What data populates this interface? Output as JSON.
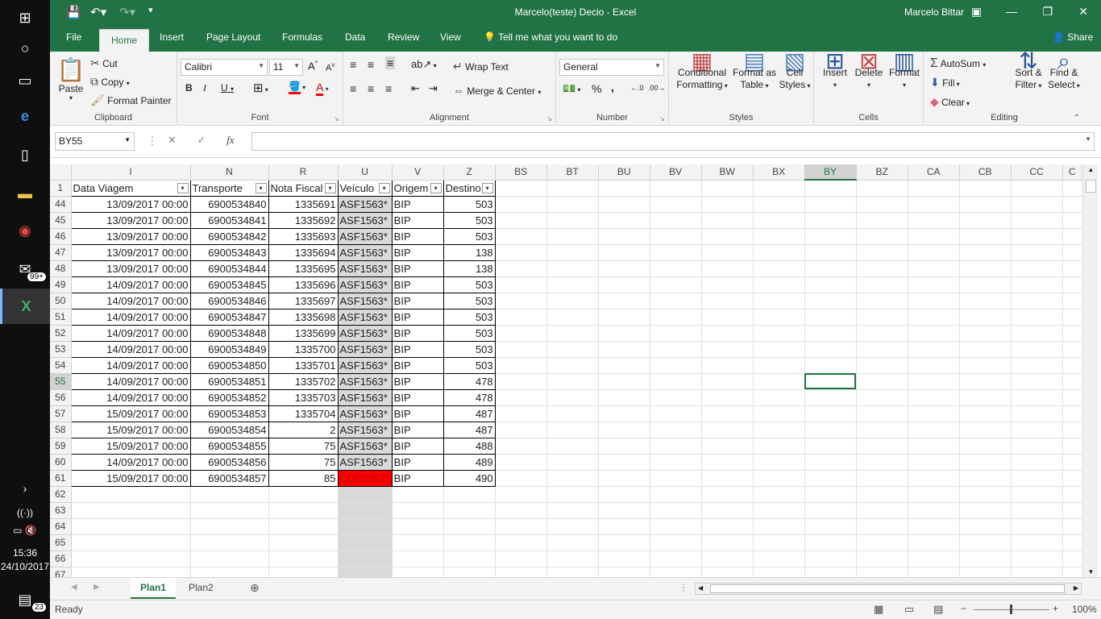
{
  "taskbar": {
    "time": "15:36",
    "date": "24/10/2017",
    "mail_badge": "99+",
    "notif_count": "23"
  },
  "window": {
    "title": "Marcelo(teste) Decio  -  Excel",
    "user": "Marcelo Bittar"
  },
  "ribbon_tabs": [
    "File",
    "Home",
    "Insert",
    "Page Layout",
    "Formulas",
    "Data",
    "Review",
    "View"
  ],
  "tell_me": "Tell me what you want to do",
  "share": "Share",
  "clipboard": {
    "paste": "Paste",
    "cut": "Cut",
    "copy": "Copy",
    "format_painter": "Format Painter",
    "label": "Clipboard"
  },
  "font": {
    "name": "Calibri",
    "size": "11",
    "label": "Font",
    "bold": "B",
    "italic": "I",
    "underline": "U"
  },
  "alignment": {
    "wrap": "Wrap Text",
    "merge": "Merge & Center",
    "label": "Alignment"
  },
  "number": {
    "format": "General",
    "percent": "%",
    "comma": ",",
    "label": "Number"
  },
  "styles": {
    "cond1": "Conditional",
    "cond2": "Formatting",
    "fmt1": "Format as",
    "fmt2": "Table",
    "cell1": "Cell",
    "cell2": "Styles",
    "label": "Styles"
  },
  "cells": {
    "insert": "Insert",
    "delete": "Delete",
    "format": "Format",
    "label": "Cells"
  },
  "editing": {
    "autosum": "AutoSum",
    "fill": "Fill",
    "clear": "Clear",
    "sort1": "Sort &",
    "sort2": "Filter",
    "find1": "Find &",
    "find2": "Select",
    "label": "Editing"
  },
  "namebox": "BY55",
  "fx": "fx",
  "columns": [
    "I",
    "N",
    "R",
    "U",
    "V",
    "Z",
    "BS",
    "BT",
    "BU",
    "BV",
    "BW",
    "BX",
    "BY",
    "BZ",
    "CA",
    "CB",
    "CC",
    "C"
  ],
  "header_row": {
    "num": "1",
    "cells": [
      "Data Viagem",
      "Transporte",
      "Nota Fiscal",
      "Veículo",
      "Origem",
      "Destino"
    ]
  },
  "rows": [
    {
      "n": "44",
      "d": "13/09/2017 00:00",
      "t": "6900534840",
      "nf": "1335691",
      "v": "ASF1563*",
      "o": "BIP",
      "z": "503"
    },
    {
      "n": "45",
      "d": "13/09/2017 00:00",
      "t": "6900534841",
      "nf": "1335692",
      "v": "ASF1563*",
      "o": "BIP",
      "z": "503"
    },
    {
      "n": "46",
      "d": "13/09/2017 00:00",
      "t": "6900534842",
      "nf": "1335693",
      "v": "ASF1563*",
      "o": "BIP",
      "z": "503"
    },
    {
      "n": "47",
      "d": "13/09/2017 00:00",
      "t": "6900534843",
      "nf": "1335694",
      "v": "ASF1563*",
      "o": "BIP",
      "z": "138"
    },
    {
      "n": "48",
      "d": "13/09/2017 00:00",
      "t": "6900534844",
      "nf": "1335695",
      "v": "ASF1563*",
      "o": "BIP",
      "z": "138"
    },
    {
      "n": "49",
      "d": "14/09/2017 00:00",
      "t": "6900534845",
      "nf": "1335696",
      "v": "ASF1563*",
      "o": "BIP",
      "z": "503"
    },
    {
      "n": "50",
      "d": "14/09/2017 00:00",
      "t": "6900534846",
      "nf": "1335697",
      "v": "ASF1563*",
      "o": "BIP",
      "z": "503"
    },
    {
      "n": "51",
      "d": "14/09/2017 00:00",
      "t": "6900534847",
      "nf": "1335698",
      "v": "ASF1563*",
      "o": "BIP",
      "z": "503"
    },
    {
      "n": "52",
      "d": "14/09/2017 00:00",
      "t": "6900534848",
      "nf": "1335699",
      "v": "ASF1563*",
      "o": "BIP",
      "z": "503"
    },
    {
      "n": "53",
      "d": "14/09/2017 00:00",
      "t": "6900534849",
      "nf": "1335700",
      "v": "ASF1563*",
      "o": "BIP",
      "z": "503"
    },
    {
      "n": "54",
      "d": "14/09/2017 00:00",
      "t": "6900534850",
      "nf": "1335701",
      "v": "ASF1563*",
      "o": "BIP",
      "z": "503"
    },
    {
      "n": "55",
      "d": "14/09/2017 00:00",
      "t": "6900534851",
      "nf": "1335702",
      "v": "ASF1563*",
      "o": "BIP",
      "z": "478"
    },
    {
      "n": "56",
      "d": "14/09/2017 00:00",
      "t": "6900534852",
      "nf": "1335703",
      "v": "ASF1563*",
      "o": "BIP",
      "z": "478"
    },
    {
      "n": "57",
      "d": "15/09/2017 00:00",
      "t": "6900534853",
      "nf": "1335704",
      "v": "ASF1563*",
      "o": "BIP",
      "z": "487"
    },
    {
      "n": "58",
      "d": "15/09/2017 00:00",
      "t": "6900534854",
      "nf": "2",
      "v": "ASF1563*",
      "o": "BIP",
      "z": "487"
    },
    {
      "n": "59",
      "d": "15/09/2017 00:00",
      "t": "6900534855",
      "nf": "75",
      "v": "ASF1563*",
      "o": "BIP",
      "z": "488"
    },
    {
      "n": "60",
      "d": "14/09/2017 00:00",
      "t": "6900534856",
      "nf": "75",
      "v": "ASF1563*",
      "o": "BIP",
      "z": "489"
    },
    {
      "n": "61",
      "d": "15/09/2017 00:00",
      "t": "6900534857",
      "nf": "85",
      "v": "CUD2352*",
      "o": "BIP",
      "z": "490"
    }
  ],
  "empty_rows": [
    "62",
    "63",
    "64",
    "65",
    "66",
    "67"
  ],
  "sheets": [
    "Plan1",
    "Plan2"
  ],
  "status": {
    "ready": "Ready",
    "zoom": "100%"
  }
}
